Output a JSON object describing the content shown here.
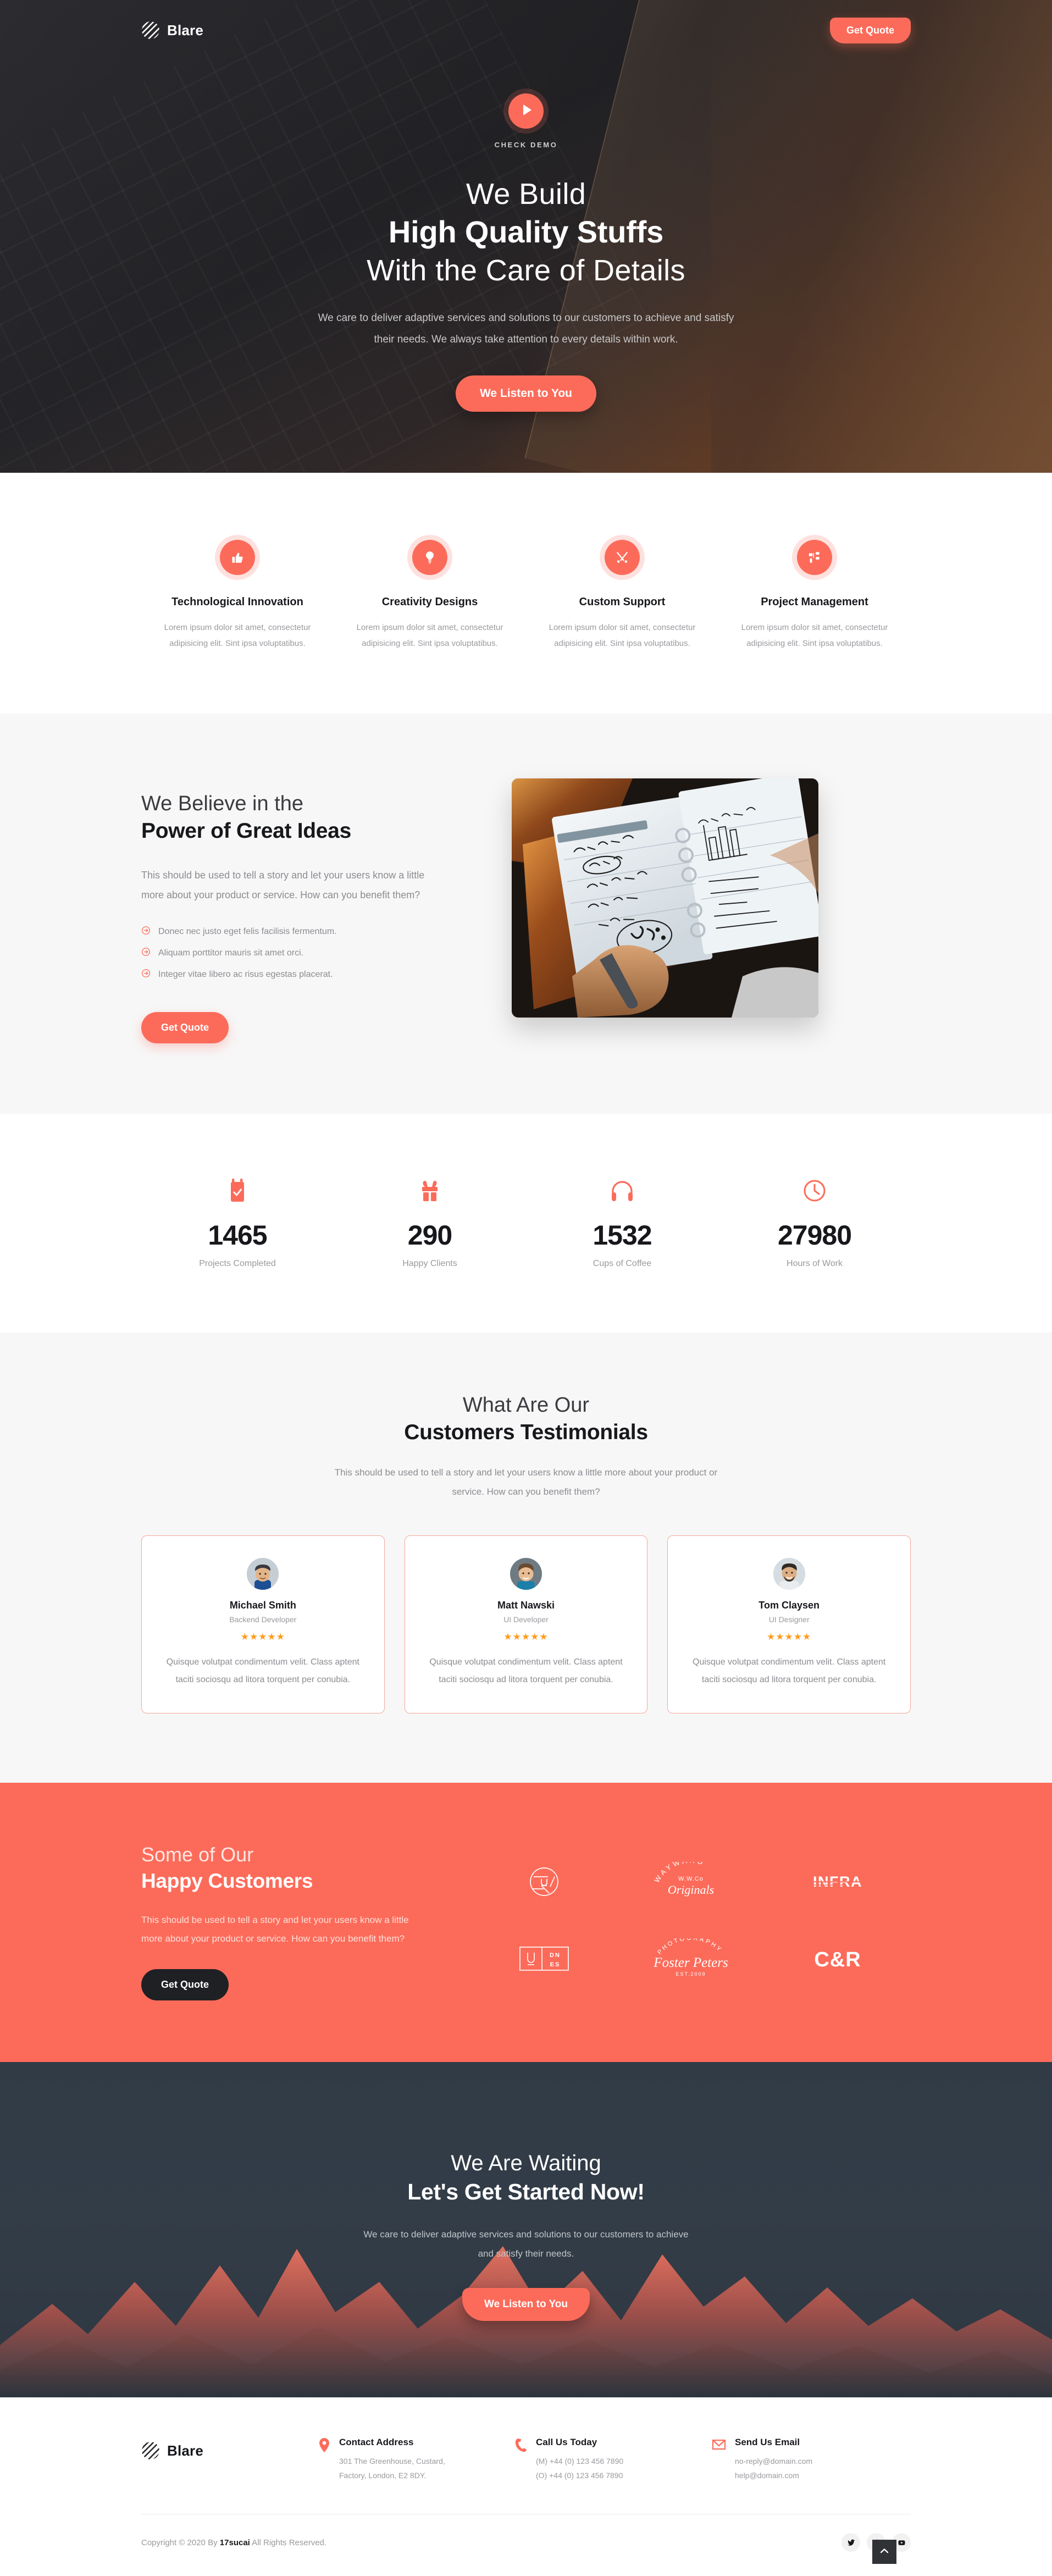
{
  "brand": {
    "name": "Blare",
    "logo_icon": "striped-circle-logo"
  },
  "header": {
    "quote_button": "Get Quote"
  },
  "hero": {
    "play_icon": "play-icon",
    "check_demo": "CHECK DEMO",
    "line1": "We Build",
    "line2": "High Quality Stuffs",
    "line3": "With the Care of Details",
    "description": "We care to deliver adaptive services and solutions to our customers to achieve and satisfy their needs. We always take attention to every details within work.",
    "cta_button": "We Listen to You"
  },
  "services": [
    {
      "icon": "thumbs-up-icon",
      "title": "Technological Innovation",
      "text": "Lorem ipsum dolor sit amet, consectetur adipisicing elit. Sint ipsa voluptatibus."
    },
    {
      "icon": "lightbulb-icon",
      "title": "Creativity Designs",
      "text": "Lorem ipsum dolor sit amet, consectetur adipisicing elit. Sint ipsa voluptatibus."
    },
    {
      "icon": "tools-icon",
      "title": "Custom Support",
      "text": "Lorem ipsum dolor sit amet, consectetur adipisicing elit. Sint ipsa voluptatibus."
    },
    {
      "icon": "sitemap-icon",
      "title": "Project Management",
      "text": "Lorem ipsum dolor sit amet, consectetur adipisicing elit. Sint ipsa voluptatibus."
    }
  ],
  "ideas": {
    "kicker": "We Believe in the",
    "headline": "Power of Great Ideas",
    "description": "This should be used to tell a story and let your users know a little more about your product or service. How can you benefit them?",
    "bullets": [
      "Donec nec justo eget felis facilisis fermentum.",
      "Aliquam porttitor mauris sit amet orci.",
      "Integer vitae libero ac risus egestas placerat."
    ],
    "button": "Get Quote",
    "image_alt": "hand-writing-in-planner-photo"
  },
  "counters": [
    {
      "icon": "calendar-check-icon",
      "value": "1465",
      "label": "Projects Completed"
    },
    {
      "icon": "gift-icon",
      "value": "290",
      "label": "Happy Clients"
    },
    {
      "icon": "headphones-icon",
      "value": "1532",
      "label": "Cups of Coffee"
    },
    {
      "icon": "clock-icon",
      "value": "27980",
      "label": "Hours of Work"
    }
  ],
  "testimonials": {
    "kicker": "What Are Our",
    "headline": "Customers Testimonials",
    "description": "This should be used to tell a story and let your users know a little more about your product or service. How can you benefit them?",
    "items": [
      {
        "name": "Michael Smith",
        "role": "Backend Developer",
        "stars": "★★★★★",
        "text": "Quisque volutpat condimentum velit. Class aptent taciti sociosqu ad litora torquent per conubia."
      },
      {
        "name": "Matt Nawski",
        "role": "UI Developer",
        "stars": "★★★★★",
        "text": "Quisque volutpat condimentum velit. Class aptent taciti sociosqu ad litora torquent per conubia."
      },
      {
        "name": "Tom Claysen",
        "role": "UI Designer",
        "stars": "★★★★★",
        "text": "Quisque volutpat condimentum velit. Class aptent taciti sociosqu ad litora torquent per conubia."
      }
    ]
  },
  "clients": {
    "kicker": "Some of Our",
    "headline": "Happy Customers",
    "description": "This should be used to tell a story and let your users know a little more about your product or service. How can you benefit them?",
    "button": "Get Quote",
    "logos": [
      {
        "name": "aperture-u-logo",
        "label": "U"
      },
      {
        "name": "wayward-originals-logo",
        "label": "WAYWARD"
      },
      {
        "name": "infra-logo",
        "label": "INFRA"
      },
      {
        "name": "udnes-logo",
        "label": "U DN ES"
      },
      {
        "name": "foster-peters-photography-logo",
        "label": "Foster Peters"
      },
      {
        "name": "c-and-r-logo",
        "label": "C&R"
      }
    ],
    "wayward_sub": "W.W.Co",
    "wayward_script": "Originals",
    "foster_top": "PHOTOGRAPHY",
    "foster_script": "Foster Peters",
    "foster_est": "EST.2009"
  },
  "cta": {
    "kicker": "We Are Waiting",
    "headline": "Let's Get Started Now!",
    "description": "We care to deliver adaptive services and solutions to our customers to achieve and satisfy their needs.",
    "button": "We Listen to You"
  },
  "footer": {
    "contact": [
      {
        "icon": "map-pin-icon",
        "title": "Contact Address",
        "line1": "301 The Greenhouse, Custard,",
        "line2": "Factory, London, E2 8DY."
      },
      {
        "icon": "phone-icon",
        "title": "Call Us Today",
        "line1": "(M) +44 (0) 123 456 7890",
        "line2": "(O) +44 (0) 123 456 7890"
      },
      {
        "icon": "envelope-icon",
        "title": "Send Us Email",
        "line1": "no-reply@domain.com",
        "line2": "help@domain.com"
      }
    ],
    "copyright_pre": "Copyright © 2020 By ",
    "copyright_brand": "17sucai",
    "copyright_post": " All Rights Reserved.",
    "socials": [
      {
        "name": "twitter-icon"
      },
      {
        "name": "facebook-icon"
      },
      {
        "name": "youtube-icon"
      }
    ],
    "scroll_top_icon": "chevron-up-icon"
  },
  "colors": {
    "accent": "#fc6b5a",
    "dark": "#1f2023",
    "muted": "#9a9a9f",
    "cta_bg": "#303b46",
    "star": "#ff9c1a"
  }
}
